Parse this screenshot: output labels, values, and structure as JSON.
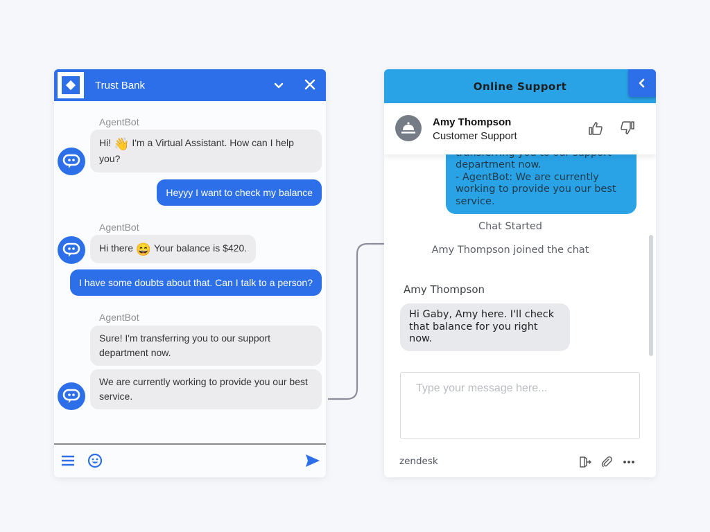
{
  "bank_widget": {
    "title": "Trust Bank",
    "icons": {
      "logo": "diamond-logo-icon",
      "minimize": "chevron-down-icon",
      "close": "close-icon",
      "bot_avatar": "chat-bubble-icon",
      "menu": "hamburger-menu-icon",
      "emoji": "smiley-icon",
      "send": "send-icon"
    },
    "messages": [
      {
        "from": "bot",
        "sender": "AgentBot",
        "prefix": "Hi!",
        "emoji": "👋",
        "text": "I'm a Virtual Assistant. How can I help you?"
      },
      {
        "from": "user",
        "text": "Heyyy I want to check my balance"
      },
      {
        "from": "bot",
        "sender": "AgentBot",
        "prefix": "Hi there",
        "emoji": "😄",
        "text": "Your balance is $420."
      },
      {
        "from": "user",
        "text": "I have some doubts about that. Can I talk to a person?"
      },
      {
        "from": "bot",
        "sender": "AgentBot",
        "text": "Sure! I'm transferring you to our support department now."
      },
      {
        "from": "bot",
        "text": "We are currently working to provide you our best service."
      }
    ]
  },
  "support_widget": {
    "title": "Online Support",
    "icons": {
      "back": "chevron-left-icon",
      "agent_avatar": "service-bell-icon",
      "thumbs_up": "thumbs-up-icon",
      "thumbs_down": "thumbs-down-icon",
      "end_chat": "exit-icon",
      "attach": "paperclip-icon",
      "more": "more-dots-icon"
    },
    "agent": {
      "name": "Amy Thompson",
      "role": "Customer Support"
    },
    "transcript": "- AgentBot: Sure! I'm\ntransferring you to our support department now.\n- AgentBot: We are currently working to provide you our best service.",
    "system_messages": [
      "Chat Started",
      "Amy Thompson joined the chat"
    ],
    "agent_message": {
      "sender": "Amy Thompson",
      "text": "Hi Gaby, Amy here. I'll check that balance for you right now."
    },
    "input": {
      "value": "",
      "placeholder": "Type your message here..."
    },
    "brand": "zendesk"
  }
}
